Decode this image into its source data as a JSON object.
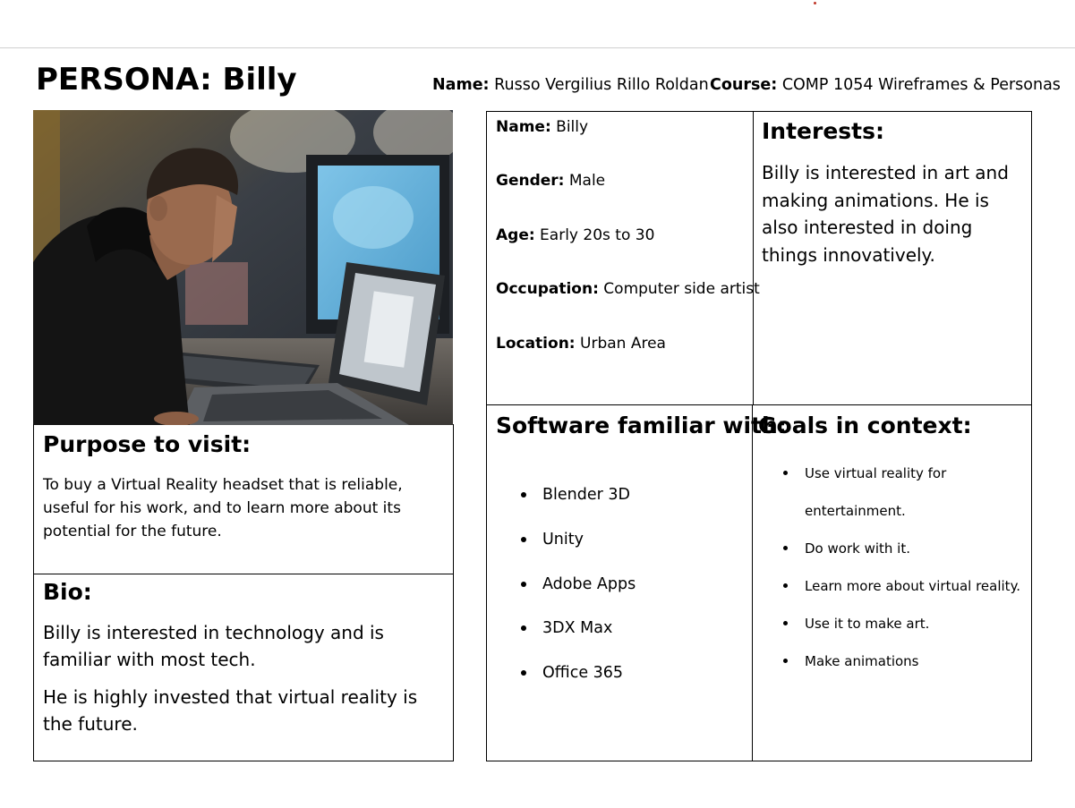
{
  "header": {
    "title": "PERSONA: Billy",
    "name_label": "Name:",
    "name_value": " Russo Vergilius Rillo Roldan",
    "course_label": "Course:",
    "course_value": " COMP 1054 Wireframes & Personas"
  },
  "photo": {
    "icon": "persona-photo"
  },
  "purpose": {
    "heading": "Purpose to visit:",
    "text": "To buy a Virtual Reality headset that is reliable, useful for his work, and to learn more about its potential for the future."
  },
  "bio": {
    "heading": "Bio:",
    "p1": "Billy is interested in technology and is familiar with most tech.",
    "p2": "He is highly invested that virtual reality is the future."
  },
  "info": {
    "name_label": "Name:",
    "name_value": " Billy",
    "gender_label": "Gender:",
    "gender_value": " Male",
    "age_label": "Age:",
    "age_value": " Early 20s to 30",
    "occupation_label": "Occupation:",
    "occupation_value": " Computer side artist",
    "location_label": "Location:",
    "location_value": " Urban Area"
  },
  "interests": {
    "heading": "Interests:",
    "text": "Billy is interested in art and making animations. He is also interested in doing things innovatively."
  },
  "software": {
    "heading": "Software familiar with:",
    "items": [
      "Blender 3D",
      "Unity",
      "Adobe Apps",
      "3DX Max",
      "Office 365"
    ]
  },
  "goals": {
    "heading": "Goals in context:",
    "items": [
      "Use virtual reality for entertainment.",
      "Do work with it.",
      "Learn more about virtual reality.",
      "Use it to make art.",
      "Make animations"
    ]
  }
}
